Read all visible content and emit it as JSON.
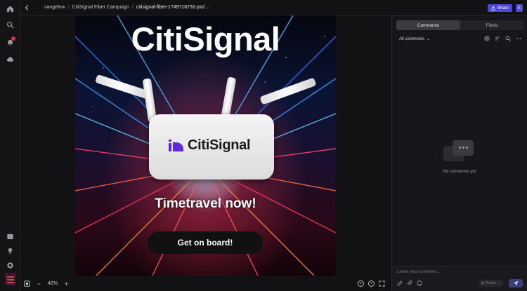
{
  "header": {
    "breadcrumbs": [
      "vangeluw",
      "CitiSignal Fiber Campaign",
      "citisignal-fiber-1749718733.psd"
    ],
    "share_label": "Share",
    "user_initial": "E"
  },
  "rail": {
    "icons": [
      "home-icon",
      "search-icon",
      "notifications-icon",
      "cloud-icon",
      "learn-icon",
      "lightbulb-icon",
      "help-icon"
    ],
    "notification_badge": true
  },
  "artboard": {
    "headline": "CitiSignal",
    "router_logo_text": "CitiSignal",
    "tagline": "Timetravel now!",
    "cta_label": "Get on board!",
    "colors": {
      "logo_purple": "#5b2bd6",
      "cta_bg": "#111111"
    }
  },
  "zoombar": {
    "zoom_level": "42%",
    "minus": "−",
    "plus": "+"
  },
  "panel": {
    "tabs": [
      {
        "label": "Comments",
        "active": true
      },
      {
        "label": "Fields",
        "active": false
      }
    ],
    "filter_label": "All comments",
    "empty_message": "No comments yet",
    "composer_placeholder": "Leave your comment...",
    "visibility_label": "Public"
  },
  "colors": {
    "accent": "#4e49d8",
    "background": "#111114",
    "panel": "#17171b"
  }
}
